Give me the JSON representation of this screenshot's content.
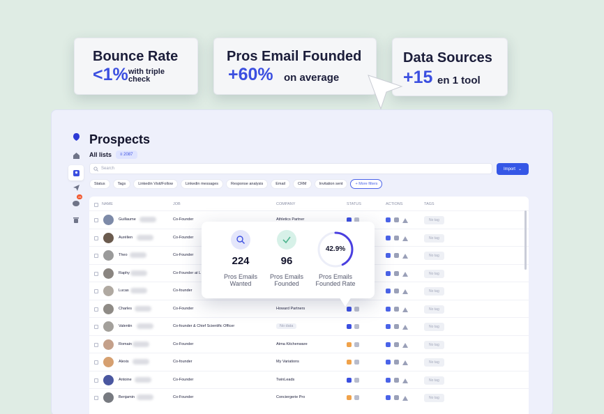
{
  "stats": {
    "bounce": {
      "title": "Bounce Rate",
      "value": "<1%",
      "note_line1": "with triple",
      "note_line2": "check"
    },
    "emails": {
      "title": "Pros Email Founded",
      "value": "+60%",
      "note": "on average"
    },
    "sources": {
      "title": "Data Sources",
      "value": "+15",
      "note": "en 1 tool"
    }
  },
  "app": {
    "page_title": "Prospects",
    "list_title": "All lists",
    "list_count": "2087",
    "search_placeholder": "Search",
    "import_label": "Import",
    "filters": [
      "Status",
      "Tags",
      "Linkedin Visit/Follow",
      "Linkedin messages",
      "Response analysis",
      "Email",
      "CRM",
      "Invitation sent"
    ],
    "more_filters": "More filters",
    "notification_count": "28"
  },
  "table": {
    "headers": {
      "name": "NAME",
      "job": "JOB",
      "company": "COMPANY",
      "status": "STATUS",
      "actions": "ACTIONS",
      "tags": "TAGS"
    },
    "no_tag": "No tag",
    "rows": [
      {
        "name": "Guillaume",
        "job": "Co-Founder",
        "company": "Athletics Partner",
        "status": "blue"
      },
      {
        "name": "Aurélien",
        "job": "Co-Founder",
        "company": "",
        "status": "blue"
      },
      {
        "name": "Theo",
        "job": "Co-Founder",
        "company": "",
        "status": "blue"
      },
      {
        "name": "Raphy",
        "job": "Co-Founder at L",
        "company": "",
        "status": "blue"
      },
      {
        "name": "Lucas",
        "job": "Co-founder",
        "company": "",
        "status": "blue"
      },
      {
        "name": "Charles",
        "job": "Co-Founder",
        "company": "Howard Partners",
        "status": "blue"
      },
      {
        "name": "Valentin",
        "job": "Co-founder & Chief Scientific Officer",
        "company": "No data",
        "status": "blue"
      },
      {
        "name": "Romain",
        "job": "Co-Founder",
        "company": "Atma Kitchenware",
        "status": "orange"
      },
      {
        "name": "Alexis",
        "job": "Co-founder",
        "company": "My Variations",
        "status": "orange"
      },
      {
        "name": "Antoine",
        "job": "Co-Founder",
        "company": "TwinLeads",
        "status": "blue"
      },
      {
        "name": "Benjamin",
        "job": "Co-Founder",
        "company": "Conciergerie Pro",
        "status": "orange"
      }
    ]
  },
  "popup": {
    "wanted": {
      "value": "224",
      "label_line1": "Pros Emails",
      "label_line2": "Wanted"
    },
    "founded": {
      "value": "96",
      "label_line1": "Pros Emails",
      "label_line2": "Founded"
    },
    "rate": {
      "value": "42.9%",
      "fraction": 0.429,
      "label_line1": "Pros Emails",
      "label_line2": "Founded Rate"
    }
  },
  "colors": {
    "accent": "#3b4fe0",
    "success": "#6cc6a4",
    "warning": "#f0a24a"
  }
}
